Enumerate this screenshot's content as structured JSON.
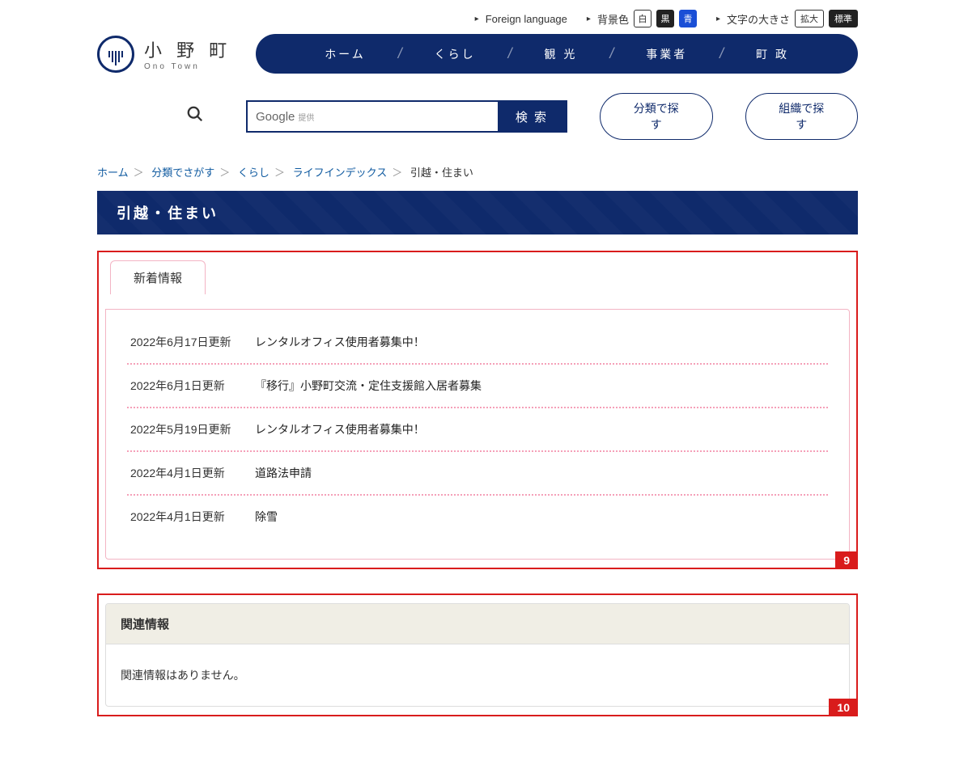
{
  "topbar": {
    "foreignLanguage": "Foreign language",
    "bgLabel": "背景色",
    "bgWhite": "白",
    "bgBlack": "黒",
    "bgBlue": "青",
    "fontLabel": "文字の大きさ",
    "fontLarge": "拡大",
    "fontNormal": "標準"
  },
  "logo": {
    "jp": "小 野 町",
    "en": "Ono Town"
  },
  "nav": {
    "home": "ホーム",
    "living": "くらし",
    "tourism": "観 光",
    "business": "事業者",
    "gov": "町 政"
  },
  "search": {
    "google": "Google",
    "sub": "提供",
    "placeholder": "",
    "btn": "検 索",
    "byCategory": "分類で探す",
    "byOrg": "組織で探す"
  },
  "breadcrumb": {
    "home": "ホーム",
    "byCategory": "分類でさがす",
    "living": "くらし",
    "lifeIndex": "ライフインデックス",
    "current": "引越・住まい"
  },
  "pageTitle": "引越・住まい",
  "newsTab": "新着情報",
  "news": [
    {
      "date": "2022年6月17日更新",
      "title": "レンタルオフィス使用者募集中！"
    },
    {
      "date": "2022年6月1日更新",
      "title": "『移行』小野町交流・定住支援館入居者募集"
    },
    {
      "date": "2022年5月19日更新",
      "title": "レンタルオフィス使用者募集中！"
    },
    {
      "date": "2022年4月1日更新",
      "title": "道路法申請"
    },
    {
      "date": "2022年4月1日更新",
      "title": "除雪"
    }
  ],
  "related": {
    "heading": "関連情報",
    "empty": "関連情報はありません。"
  },
  "badges": {
    "box1": "9",
    "box2": "10"
  }
}
